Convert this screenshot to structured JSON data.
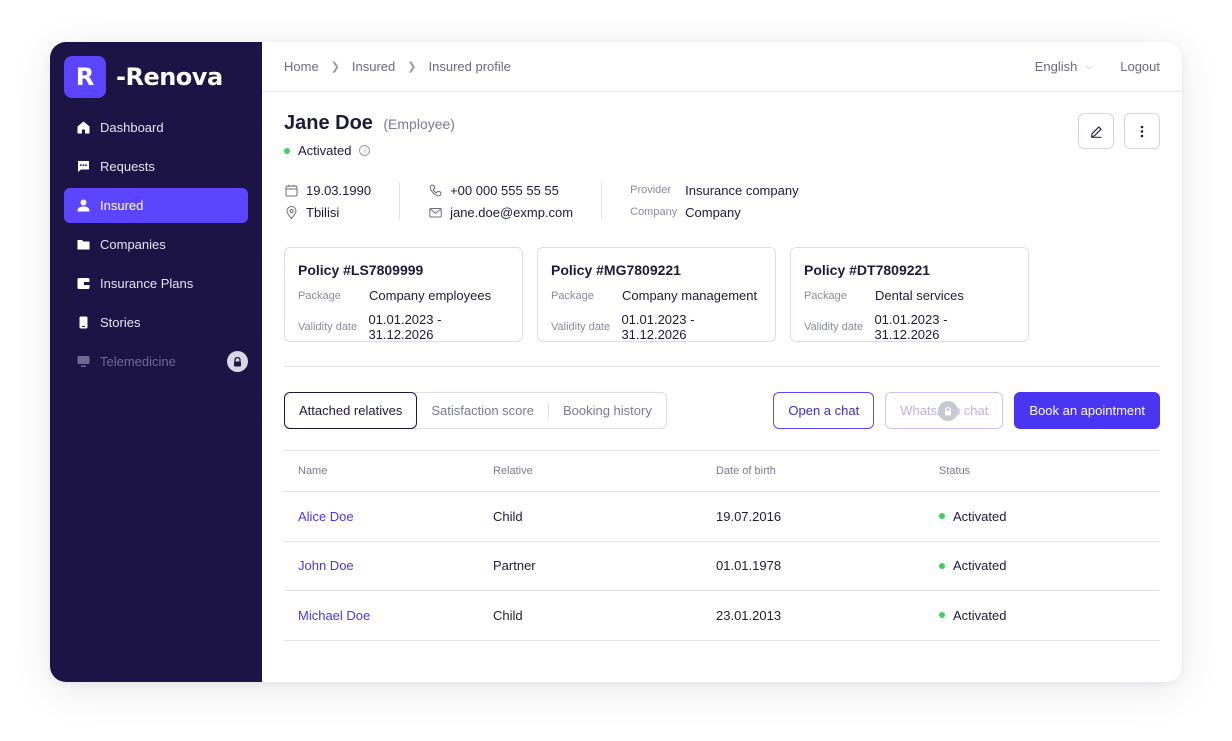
{
  "brand": {
    "mark": "R",
    "name": "-Renova"
  },
  "sidebar": {
    "items": [
      {
        "label": "Dashboard",
        "icon": "home-icon"
      },
      {
        "label": "Requests",
        "icon": "chat-icon"
      },
      {
        "label": "Insured",
        "icon": "user-icon",
        "active": true
      },
      {
        "label": "Companies",
        "icon": "folder-icon"
      },
      {
        "label": "Insurance Plans",
        "icon": "wallet-icon"
      },
      {
        "label": "Stories",
        "icon": "phone-icon"
      },
      {
        "label": "Telemedicine",
        "icon": "monitor-icon",
        "disabled": true
      }
    ]
  },
  "breadcrumb": [
    "Home",
    "Insured",
    "Insured profile"
  ],
  "topbar": {
    "language": "English",
    "logout": "Logout"
  },
  "profile": {
    "name": "Jane Doe",
    "role": "(Employee)",
    "status": "Activated",
    "birth_date": "19.03.1990",
    "city": "Tbilisi",
    "phone": "+00 000 555 55 55",
    "email": "jane.doe@exmp.com",
    "provider_label": "Provider",
    "provider": "Insurance company",
    "company_label": "Company",
    "company": "Company"
  },
  "policies": [
    {
      "title": "Policy #LS7809999",
      "package_label": "Package",
      "package": "Company employees",
      "validity_label": "Validity date",
      "validity": "01.01.2023 - 31.12.2026"
    },
    {
      "title": "Policy #MG7809221",
      "package_label": "Package",
      "package": "Company management",
      "validity_label": "Validity date",
      "validity": "01.01.2023 - 31.12.2026"
    },
    {
      "title": "Policy #DT7809221",
      "package_label": "Package",
      "package": "Dental services",
      "validity_label": "Validity date",
      "validity": "01.01.2023 - 31.12.2026"
    }
  ],
  "tabs": [
    "Attached relatives",
    "Satisfaction score",
    "Booking history"
  ],
  "actions": {
    "open_chat": "Open a chat",
    "whatsapp_chat": "WhatsApp chat",
    "book": "Book an apointment"
  },
  "table": {
    "headers": [
      "Name",
      "Relative",
      "Date of birth",
      "Status"
    ],
    "rows": [
      {
        "name": "Alice Doe",
        "relative": "Child",
        "dob": "19.07.2016",
        "status": "Activated"
      },
      {
        "name": "John Doe",
        "relative": "Partner",
        "dob": "01.01.1978",
        "status": "Activated"
      },
      {
        "name": "Michael Doe",
        "relative": "Child",
        "dob": "23.01.2013",
        "status": "Activated"
      }
    ]
  },
  "colors": {
    "accent": "#5b45ff",
    "sidebar": "#1c1445",
    "status_green": "#3ccf5a"
  }
}
